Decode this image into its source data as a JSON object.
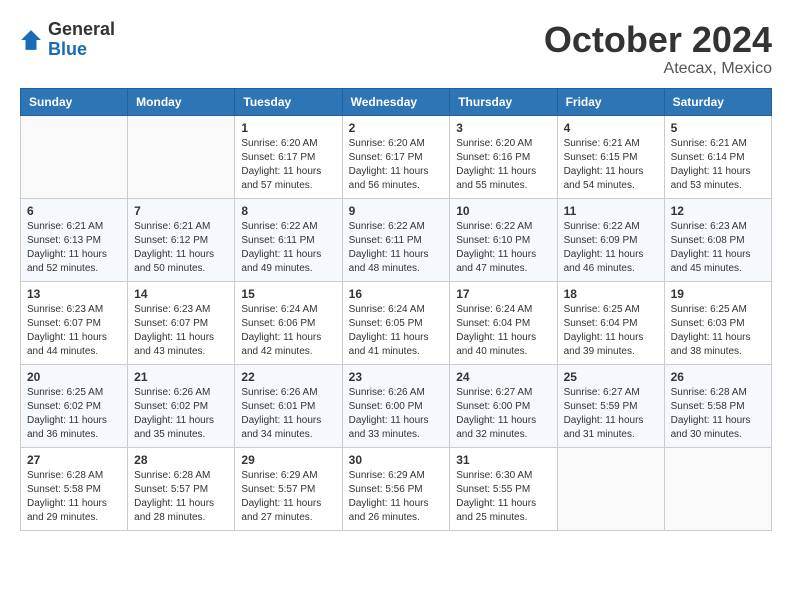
{
  "header": {
    "logo_general": "General",
    "logo_blue": "Blue",
    "month_title": "October 2024",
    "location": "Atecax, Mexico"
  },
  "days_of_week": [
    "Sunday",
    "Monday",
    "Tuesday",
    "Wednesday",
    "Thursday",
    "Friday",
    "Saturday"
  ],
  "weeks": [
    [
      {
        "day": "",
        "info": ""
      },
      {
        "day": "",
        "info": ""
      },
      {
        "day": "1",
        "info": "Sunrise: 6:20 AM\nSunset: 6:17 PM\nDaylight: 11 hours and 57 minutes."
      },
      {
        "day": "2",
        "info": "Sunrise: 6:20 AM\nSunset: 6:17 PM\nDaylight: 11 hours and 56 minutes."
      },
      {
        "day": "3",
        "info": "Sunrise: 6:20 AM\nSunset: 6:16 PM\nDaylight: 11 hours and 55 minutes."
      },
      {
        "day": "4",
        "info": "Sunrise: 6:21 AM\nSunset: 6:15 PM\nDaylight: 11 hours and 54 minutes."
      },
      {
        "day": "5",
        "info": "Sunrise: 6:21 AM\nSunset: 6:14 PM\nDaylight: 11 hours and 53 minutes."
      }
    ],
    [
      {
        "day": "6",
        "info": "Sunrise: 6:21 AM\nSunset: 6:13 PM\nDaylight: 11 hours and 52 minutes."
      },
      {
        "day": "7",
        "info": "Sunrise: 6:21 AM\nSunset: 6:12 PM\nDaylight: 11 hours and 50 minutes."
      },
      {
        "day": "8",
        "info": "Sunrise: 6:22 AM\nSunset: 6:11 PM\nDaylight: 11 hours and 49 minutes."
      },
      {
        "day": "9",
        "info": "Sunrise: 6:22 AM\nSunset: 6:11 PM\nDaylight: 11 hours and 48 minutes."
      },
      {
        "day": "10",
        "info": "Sunrise: 6:22 AM\nSunset: 6:10 PM\nDaylight: 11 hours and 47 minutes."
      },
      {
        "day": "11",
        "info": "Sunrise: 6:22 AM\nSunset: 6:09 PM\nDaylight: 11 hours and 46 minutes."
      },
      {
        "day": "12",
        "info": "Sunrise: 6:23 AM\nSunset: 6:08 PM\nDaylight: 11 hours and 45 minutes."
      }
    ],
    [
      {
        "day": "13",
        "info": "Sunrise: 6:23 AM\nSunset: 6:07 PM\nDaylight: 11 hours and 44 minutes."
      },
      {
        "day": "14",
        "info": "Sunrise: 6:23 AM\nSunset: 6:07 PM\nDaylight: 11 hours and 43 minutes."
      },
      {
        "day": "15",
        "info": "Sunrise: 6:24 AM\nSunset: 6:06 PM\nDaylight: 11 hours and 42 minutes."
      },
      {
        "day": "16",
        "info": "Sunrise: 6:24 AM\nSunset: 6:05 PM\nDaylight: 11 hours and 41 minutes."
      },
      {
        "day": "17",
        "info": "Sunrise: 6:24 AM\nSunset: 6:04 PM\nDaylight: 11 hours and 40 minutes."
      },
      {
        "day": "18",
        "info": "Sunrise: 6:25 AM\nSunset: 6:04 PM\nDaylight: 11 hours and 39 minutes."
      },
      {
        "day": "19",
        "info": "Sunrise: 6:25 AM\nSunset: 6:03 PM\nDaylight: 11 hours and 38 minutes."
      }
    ],
    [
      {
        "day": "20",
        "info": "Sunrise: 6:25 AM\nSunset: 6:02 PM\nDaylight: 11 hours and 36 minutes."
      },
      {
        "day": "21",
        "info": "Sunrise: 6:26 AM\nSunset: 6:02 PM\nDaylight: 11 hours and 35 minutes."
      },
      {
        "day": "22",
        "info": "Sunrise: 6:26 AM\nSunset: 6:01 PM\nDaylight: 11 hours and 34 minutes."
      },
      {
        "day": "23",
        "info": "Sunrise: 6:26 AM\nSunset: 6:00 PM\nDaylight: 11 hours and 33 minutes."
      },
      {
        "day": "24",
        "info": "Sunrise: 6:27 AM\nSunset: 6:00 PM\nDaylight: 11 hours and 32 minutes."
      },
      {
        "day": "25",
        "info": "Sunrise: 6:27 AM\nSunset: 5:59 PM\nDaylight: 11 hours and 31 minutes."
      },
      {
        "day": "26",
        "info": "Sunrise: 6:28 AM\nSunset: 5:58 PM\nDaylight: 11 hours and 30 minutes."
      }
    ],
    [
      {
        "day": "27",
        "info": "Sunrise: 6:28 AM\nSunset: 5:58 PM\nDaylight: 11 hours and 29 minutes."
      },
      {
        "day": "28",
        "info": "Sunrise: 6:28 AM\nSunset: 5:57 PM\nDaylight: 11 hours and 28 minutes."
      },
      {
        "day": "29",
        "info": "Sunrise: 6:29 AM\nSunset: 5:57 PM\nDaylight: 11 hours and 27 minutes."
      },
      {
        "day": "30",
        "info": "Sunrise: 6:29 AM\nSunset: 5:56 PM\nDaylight: 11 hours and 26 minutes."
      },
      {
        "day": "31",
        "info": "Sunrise: 6:30 AM\nSunset: 5:55 PM\nDaylight: 11 hours and 25 minutes."
      },
      {
        "day": "",
        "info": ""
      },
      {
        "day": "",
        "info": ""
      }
    ]
  ]
}
